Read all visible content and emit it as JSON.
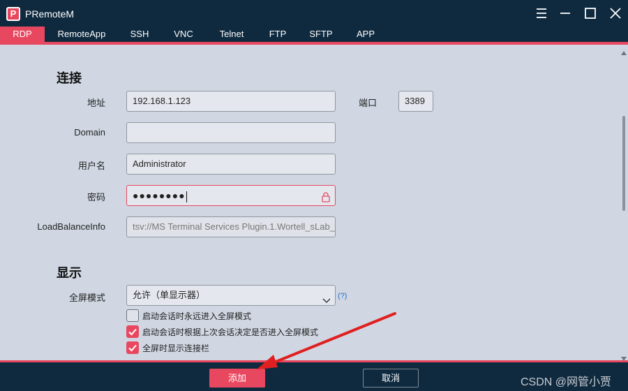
{
  "app": {
    "title": "PRemoteM",
    "logo_letter": "P"
  },
  "tabs": [
    {
      "label": "RDP",
      "active": true
    },
    {
      "label": "RemoteApp"
    },
    {
      "label": "SSH"
    },
    {
      "label": "VNC"
    },
    {
      "label": "Telnet"
    },
    {
      "label": "FTP"
    },
    {
      "label": "SFTP"
    },
    {
      "label": "APP"
    }
  ],
  "connection": {
    "section_title": "连接",
    "address_label": "地址",
    "address_value": "192.168.1.123",
    "port_label": "端口",
    "port_value": "3389",
    "domain_label": "Domain",
    "domain_value": "",
    "username_label": "用户名",
    "username_value": "Administrator",
    "password_label": "密码",
    "password_value": "●●●●●●●●",
    "loadbalance_label": "LoadBalanceInfo",
    "loadbalance_value": "tsv://MS Terminal Services Plugin.1.Wortell_sLab_"
  },
  "display": {
    "section_title": "显示",
    "fullscreen_label": "全屏模式",
    "fullscreen_value": "允许（单显示器）",
    "help_text": "(?)",
    "options": [
      {
        "label": "启动会话时永远进入全屏模式",
        "checked": false
      },
      {
        "label": "启动会话时根据上次会话决定是否进入全屏模式",
        "checked": true
      },
      {
        "label": "全屏时显示连接栏",
        "checked": true
      }
    ]
  },
  "footer": {
    "add_label": "添加",
    "cancel_label": "取消",
    "watermark": "CSDN @网管小贾"
  },
  "colors": {
    "accent": "#e8485f",
    "dark": "#0f2a3f",
    "panel": "#d0d7e2"
  }
}
